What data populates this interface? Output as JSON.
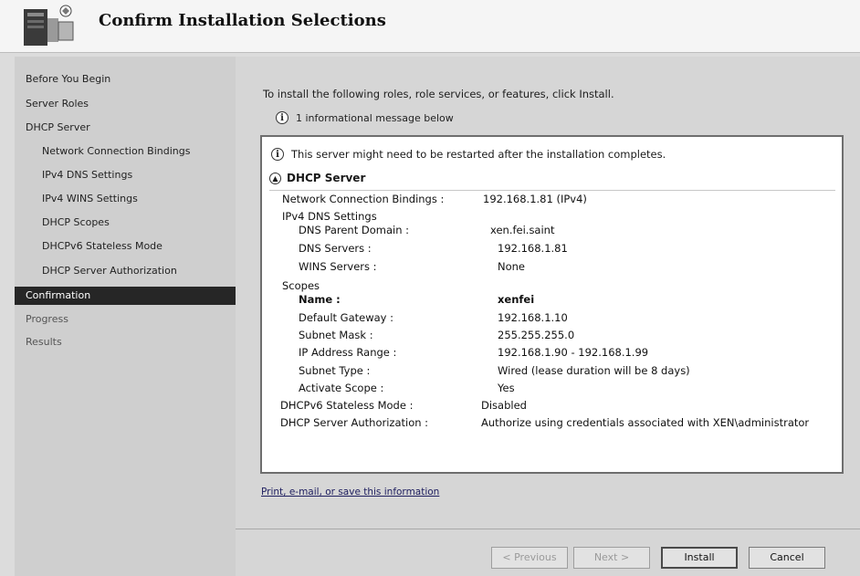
{
  "header": {
    "title": "Confirm Installation Selections",
    "icon": "server-wizard-icon"
  },
  "sidebar": {
    "items": [
      {
        "label": "Before You Begin",
        "level": 0,
        "state": "done"
      },
      {
        "label": "Server Roles",
        "level": 0,
        "state": "done"
      },
      {
        "label": "DHCP Server",
        "level": 0,
        "state": "done"
      },
      {
        "label": "Network Connection Bindings",
        "level": 1,
        "state": "done"
      },
      {
        "label": "IPv4 DNS Settings",
        "level": 1,
        "state": "done"
      },
      {
        "label": "IPv4 WINS Settings",
        "level": 1,
        "state": "done"
      },
      {
        "label": "DHCP Scopes",
        "level": 1,
        "state": "done"
      },
      {
        "label": "DHCPv6 Stateless Mode",
        "level": 1,
        "state": "done"
      },
      {
        "label": "DHCP Server Authorization",
        "level": 1,
        "state": "done"
      },
      {
        "label": "Confirmation",
        "level": 0,
        "state": "current"
      },
      {
        "label": "Progress",
        "level": 0,
        "state": "pending"
      },
      {
        "label": "Results",
        "level": 0,
        "state": "pending"
      }
    ]
  },
  "main": {
    "intro": "To install the following roles, role services, or features, click Install.",
    "info_count": "1 informational message below",
    "restart_note": "This server might need to be restarted after the installation completes.",
    "section_title": "DHCP Server",
    "rows": [
      {
        "label": "Network Connection Bindings :",
        "value": "192.168.1.81 (IPv4)"
      },
      {
        "label": "IPv4 DNS Settings",
        "value": ""
      },
      {
        "label": "DNS Parent Domain :",
        "value": "xen.fei.saint"
      },
      {
        "label": "DNS Servers :",
        "value": "192.168.1.81"
      },
      {
        "label": "WINS Servers :",
        "value": "None"
      },
      {
        "label": "Scopes",
        "value": ""
      },
      {
        "label": "Name :",
        "value": "xenfei"
      },
      {
        "label": "Default Gateway :",
        "value": "192.168.1.10"
      },
      {
        "label": "Subnet Mask :",
        "value": "255.255.255.0"
      },
      {
        "label": "IP Address Range :",
        "value": "192.168.1.90 - 192.168.1.99"
      },
      {
        "label": "Subnet Type :",
        "value": "Wired (lease duration will be 8 days)"
      },
      {
        "label": "Activate Scope :",
        "value": "Yes"
      },
      {
        "label": "DHCPv6 Stateless Mode :",
        "value": "Disabled"
      },
      {
        "label": "DHCP Server Authorization :",
        "value": "Authorize using credentials associated with XEN\\administrator"
      }
    ],
    "print_link": "Print, e-mail, or save this information"
  },
  "buttons": {
    "previous": "< Previous",
    "next": "Next >",
    "install": "Install",
    "cancel": "Cancel"
  }
}
